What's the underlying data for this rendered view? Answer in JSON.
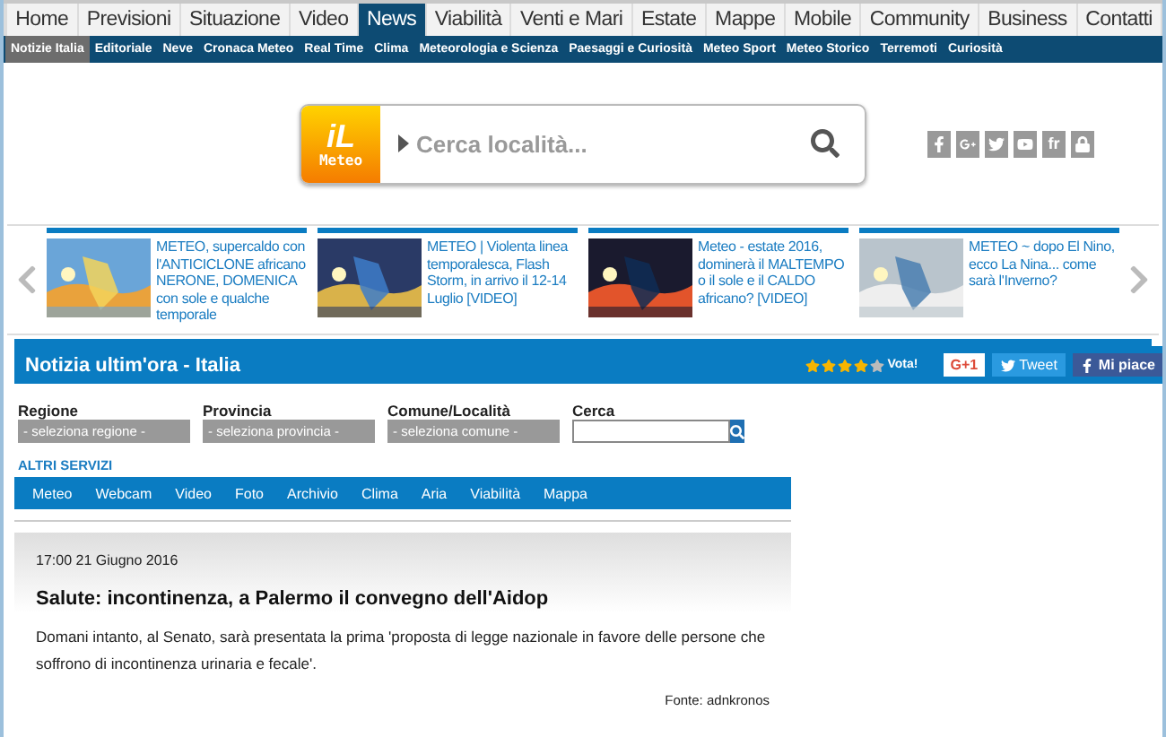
{
  "main_nav": [
    {
      "label": "Home",
      "selected": false
    },
    {
      "label": "Previsioni",
      "selected": false
    },
    {
      "label": "Situazione",
      "selected": false
    },
    {
      "label": "Video",
      "selected": false
    },
    {
      "label": "News",
      "selected": true
    },
    {
      "label": "Viabilità",
      "selected": false
    },
    {
      "label": "Venti e Mari",
      "selected": false
    },
    {
      "label": "Estate",
      "selected": false
    },
    {
      "label": "Mappe",
      "selected": false
    },
    {
      "label": "Mobile",
      "selected": false
    },
    {
      "label": "Community",
      "selected": false
    },
    {
      "label": "Business",
      "selected": false
    },
    {
      "label": "Contatti",
      "selected": false
    }
  ],
  "sub_nav": [
    {
      "label": "Notizie Italia",
      "selected": true
    },
    {
      "label": "Editoriale",
      "selected": false
    },
    {
      "label": "Neve",
      "selected": false
    },
    {
      "label": "Cronaca Meteo",
      "selected": false
    },
    {
      "label": "Real Time",
      "selected": false
    },
    {
      "label": "Clima",
      "selected": false
    },
    {
      "label": "Meteorologia e Scienza",
      "selected": false
    },
    {
      "label": "Paesaggi e Curiosità",
      "selected": false
    },
    {
      "label": "Meteo Sport",
      "selected": false
    },
    {
      "label": "Meteo Storico",
      "selected": false
    },
    {
      "label": "Terremoti",
      "selected": false
    },
    {
      "label": "Curiosità",
      "selected": false
    }
  ],
  "logo": {
    "mark": "iL",
    "name": "Meteo"
  },
  "search": {
    "placeholder": "Cerca località..."
  },
  "social": [
    {
      "kind": "facebook"
    },
    {
      "kind": "googleplus"
    },
    {
      "kind": "twitter"
    },
    {
      "kind": "youtube"
    },
    {
      "kind": "text",
      "label": "fr"
    },
    {
      "kind": "lock"
    }
  ],
  "carousel": [
    {
      "title": "METEO, supercaldo con l'ANTICICLONE africano NERONE, DOMENICA con sole e qualche temporale"
    },
    {
      "title": "METEO | Violenta linea temporalesca, Flash Storm, in arrivo il 12-14 Luglio [VIDEO]"
    },
    {
      "title": "Meteo - estate 2016, dominerà il MALTEMPO o il sole e il CALDO africano? [VIDEO]"
    },
    {
      "title": "METEO ~ dopo El Nino, ecco La Nina... come sarà l'Inverno?"
    }
  ],
  "section_bar": {
    "title": "Notizia ultim'ora - Italia",
    "stars": 4,
    "vote": "Vota!",
    "gplus": "G+1",
    "tweet": "Tweet",
    "like": "Mi piace"
  },
  "filters": [
    {
      "label": "Regione",
      "kind": "select",
      "value": "- seleziona regione -"
    },
    {
      "label": "Provincia",
      "kind": "select",
      "value": "- seleziona provincia -"
    },
    {
      "label": "Comune/Località",
      "kind": "select",
      "value": "- seleziona comune -"
    },
    {
      "label": "Cerca",
      "kind": "search"
    }
  ],
  "services": {
    "title": "ALTRI SERVIZI",
    "items": [
      "Meteo",
      "Webcam",
      "Video",
      "Foto",
      "Archivio",
      "Clima",
      "Aria",
      "Viabilità",
      "Mappa"
    ]
  },
  "article": {
    "time": "17:00 21 Giugno 2016",
    "title": "Salute: incontinenza, a Palermo il convegno dell'Aidop",
    "body": "Domani intanto, al Senato, sarà presentata la prima 'proposta di legge nazionale in favore delle persone che soffrono di incontinenza urinaria e fecale'.",
    "source": "Fonte: adnkronos"
  }
}
